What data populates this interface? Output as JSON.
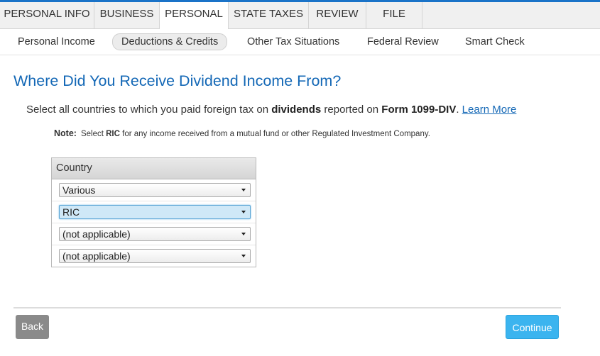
{
  "nav": {
    "main_tabs": [
      {
        "label": "PERSONAL INFO"
      },
      {
        "label": "BUSINESS"
      },
      {
        "label": "PERSONAL"
      },
      {
        "label": "STATE TAXES"
      },
      {
        "label": "REVIEW"
      },
      {
        "label": "FILE"
      }
    ],
    "active_main_tab": "PERSONAL",
    "sub_tabs": [
      {
        "label": "Personal Income"
      },
      {
        "label": "Deductions & Credits"
      },
      {
        "label": "Other Tax Situations"
      },
      {
        "label": "Federal Review"
      },
      {
        "label": "Smart Check"
      }
    ],
    "active_sub_tab": "Deductions & Credits"
  },
  "page": {
    "title": "Where Did You Receive Dividend Income From?",
    "instruction": {
      "part1": "Select all countries to which you paid foreign tax on ",
      "bold1": "dividends",
      "part2": " reported on ",
      "bold2": "Form 1099-DIV",
      "part3": ". ",
      "link": "Learn More"
    },
    "note": {
      "label": "Note:",
      "part1": "Select ",
      "bold": "RIC",
      "part2": " for any income received from a mutual fund or other Regulated Investment Company."
    }
  },
  "country_table": {
    "header": "Country",
    "rows": [
      {
        "value": "Various"
      },
      {
        "value": "RIC"
      },
      {
        "value": "(not applicable)"
      },
      {
        "value": "(not applicable)"
      }
    ]
  },
  "buttons": {
    "back": "Back",
    "continue": "Continue"
  },
  "colors": {
    "accent_blue": "#1468b6",
    "continue_button": "#3bb4ef",
    "back_button": "#8a8a8a",
    "focused_select": "#cfe8f7"
  }
}
